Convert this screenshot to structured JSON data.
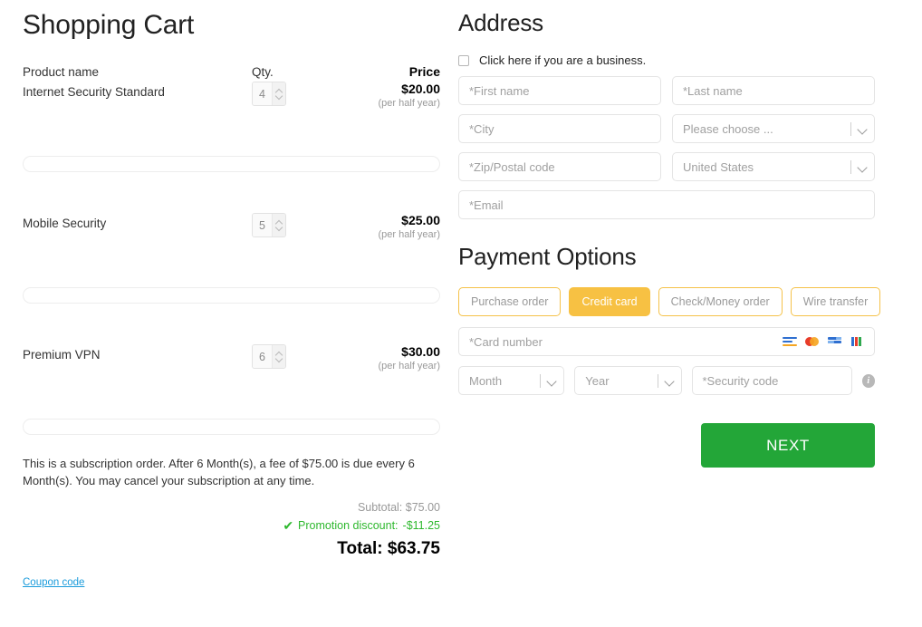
{
  "cart": {
    "title": "Shopping Cart",
    "headers": {
      "name": "Product name",
      "qty": "Qty.",
      "price": "Price"
    },
    "items": [
      {
        "name": "Internet Security Standard",
        "qty": "4",
        "price": "$20.00",
        "period": "(per half year)"
      },
      {
        "name": "Mobile Security",
        "qty": "5",
        "price": "$25.00",
        "period": "(per half year)"
      },
      {
        "name": "Premium VPN",
        "qty": "6",
        "price": "$30.00",
        "period": "(per half year)"
      }
    ],
    "subscription_note": "This is a subscription order. After 6 Month(s), a fee of $75.00 is due every 6 Month(s). You may cancel your subscription at any time.",
    "totals": {
      "subtotal_label": "Subtotal:",
      "subtotal_value": "$75.00",
      "promotion_label": "Promotion discount:",
      "promotion_value": "-$11.25",
      "promotion_check": "✔",
      "total_label": "Total:",
      "total_value": "$63.75"
    },
    "coupon_link": "Coupon code"
  },
  "address": {
    "title": "Address",
    "business_checkbox_label": "Click here if you are a business.",
    "first_name_placeholder": "*First name",
    "last_name_placeholder": "*Last name",
    "city_placeholder": "*City",
    "state_value": "Please choose ...",
    "zip_placeholder": "*Zip/Postal code",
    "country_value": "United States",
    "email_placeholder": "*Email"
  },
  "payment": {
    "title": "Payment Options",
    "tabs": [
      {
        "label": "Purchase order",
        "active": false
      },
      {
        "label": "Credit card",
        "active": true
      },
      {
        "label": "Check/Money order",
        "active": false
      },
      {
        "label": "Wire transfer",
        "active": false
      }
    ],
    "card_number_placeholder": "*Card number",
    "card_icons": [
      "visa-icon",
      "mastercard-icon",
      "amex-icon",
      "jcb-icon"
    ],
    "month_value": "Month",
    "year_value": "Year",
    "security_code_placeholder": "*Security code",
    "info_glyph": "i",
    "next_label": "NEXT"
  },
  "colors": {
    "accent_amber": "#f7c143",
    "next_green": "#23a638",
    "promo_green": "#2eb82e",
    "link_blue": "#1a9bdb"
  }
}
